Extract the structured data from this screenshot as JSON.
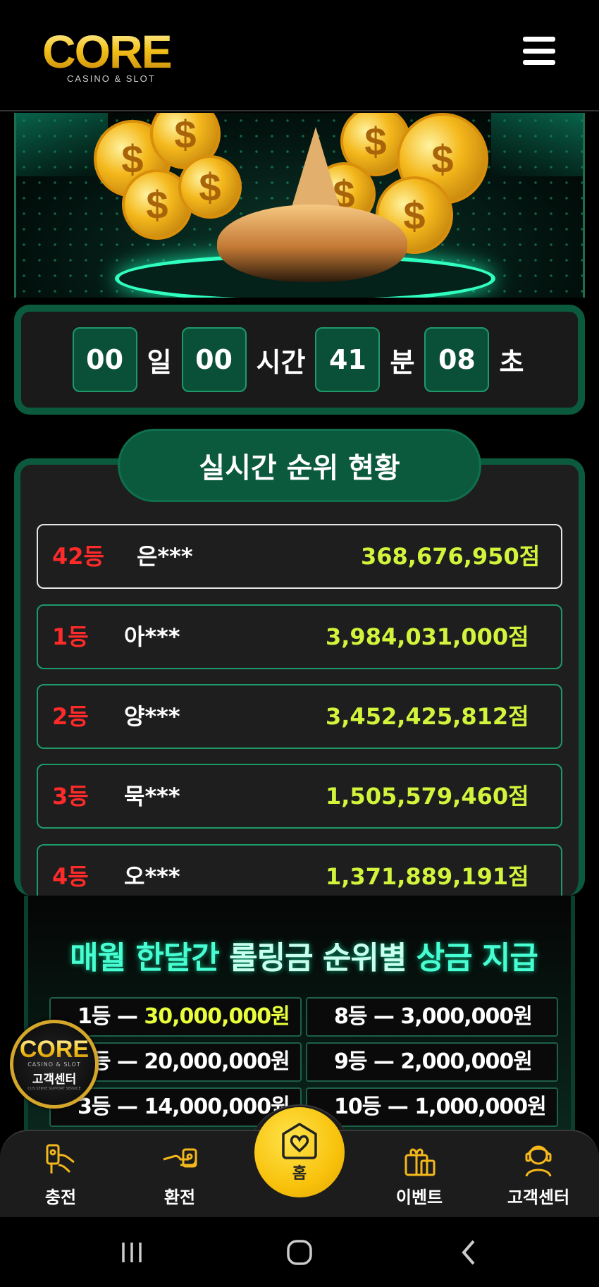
{
  "header": {
    "logo_text": "CORE",
    "logo_sub": "CASINO & SLOT",
    "menu_icon": "hamburger-menu-icon"
  },
  "countdown": {
    "days": "00",
    "days_unit": "일",
    "hours": "00",
    "hours_unit": "시간",
    "minutes": "41",
    "minutes_unit": "분",
    "seconds": "08",
    "seconds_unit": "초"
  },
  "ranking": {
    "title": "실시간 순위 현황",
    "my_rank": {
      "rank": "42등",
      "name": "은***",
      "score": "368,676,950점"
    },
    "rows": [
      {
        "rank": "1등",
        "name": "아***",
        "score": "3,984,031,000점"
      },
      {
        "rank": "2등",
        "name": "양***",
        "score": "3,452,425,812점"
      },
      {
        "rank": "3등",
        "name": "묵***",
        "score": "1,505,579,460점"
      },
      {
        "rank": "4등",
        "name": "오***",
        "score": "1,371,889,191점"
      }
    ]
  },
  "prize": {
    "title_a": "매월 한달간",
    "title_b": "롤링금 순위별",
    "title_c": "상금 지급",
    "left": [
      {
        "rank": "1등",
        "amount": "30,000,000원"
      },
      {
        "rank": "2등",
        "amount": "20,000,000원"
      },
      {
        "rank": "3등",
        "amount": "14,000,000원"
      }
    ],
    "right": [
      {
        "rank": "8등",
        "amount": "3,000,000원"
      },
      {
        "rank": "9등",
        "amount": "2,000,000원"
      },
      {
        "rank": "10등",
        "amount": "1,000,000원"
      }
    ]
  },
  "support_badge": {
    "logo": "CORE",
    "sub": "CASINO & SLOT",
    "label": "고객센터",
    "tiny": "CUS SERVE SUPPORT SERVICE"
  },
  "bottom_nav": {
    "deposit": "충전",
    "withdraw": "환전",
    "home": "홈",
    "event": "이벤트",
    "support": "고객센터"
  },
  "colors": {
    "accent_green": "#0b5a3e",
    "rank_red": "#ff2a2a",
    "score_yellow": "#d2f53c",
    "home_yellow": "#f8c20c"
  }
}
